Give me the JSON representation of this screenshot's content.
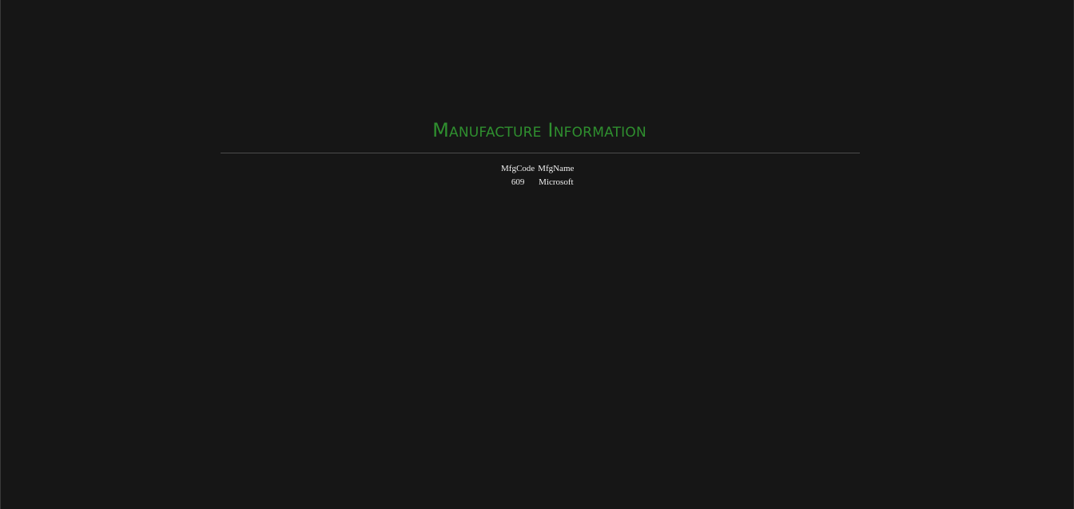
{
  "page": {
    "title": "Manufacture Information"
  },
  "table": {
    "headers": [
      "MfgCode",
      "MfgName"
    ],
    "rows": [
      {
        "code": "609",
        "name": "Microsoft"
      }
    ]
  },
  "colors": {
    "background": "#161616",
    "title": "#2f8f2f",
    "text": "#f0f0f0",
    "rule": "#4c4c4c"
  }
}
